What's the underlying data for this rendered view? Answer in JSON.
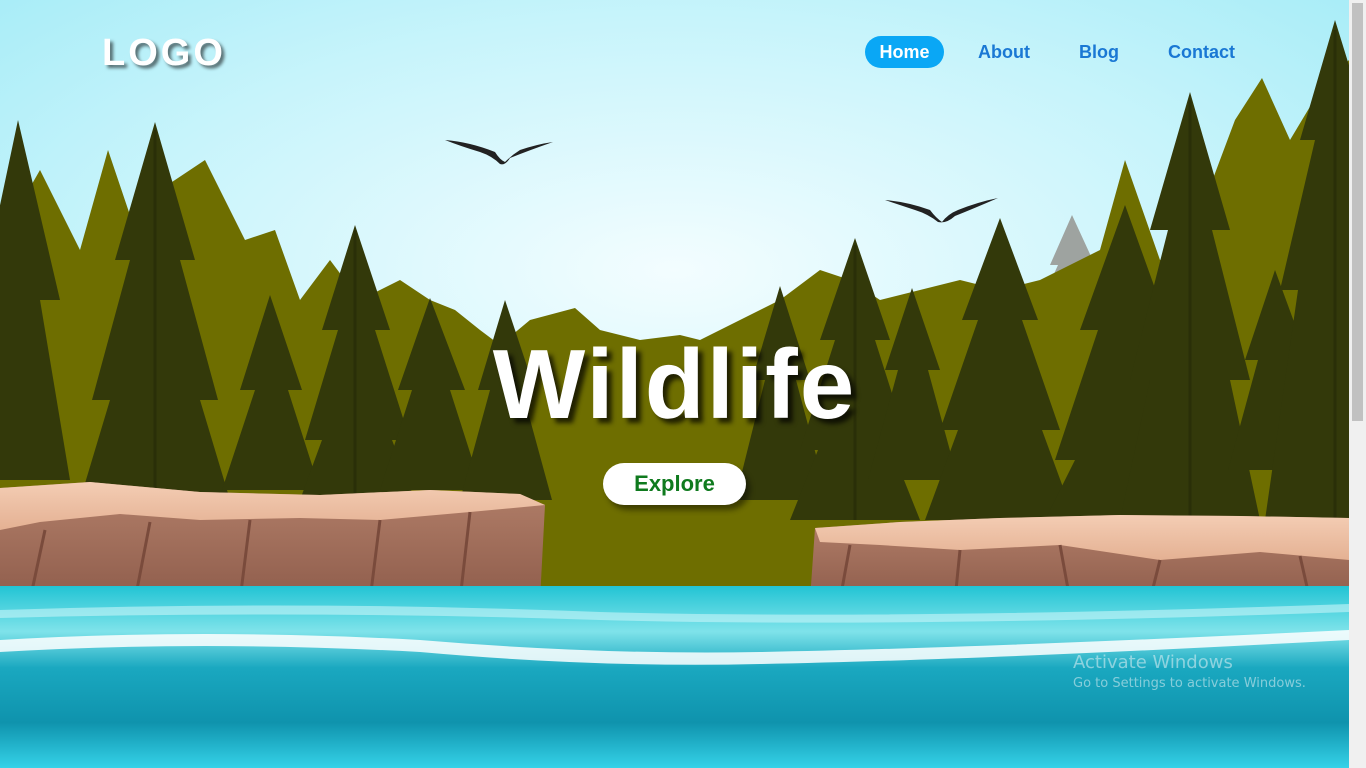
{
  "logo": {
    "text": "LOGO"
  },
  "nav": {
    "items": [
      {
        "label": "Home",
        "active": true
      },
      {
        "label": "About",
        "active": false
      },
      {
        "label": "Blog",
        "active": false
      },
      {
        "label": "Contact",
        "active": false
      }
    ]
  },
  "hero": {
    "title": "Wildlife",
    "button_label": "Explore"
  },
  "watermark": {
    "title": "Activate Windows",
    "subtitle": "Go to Settings to activate Windows."
  },
  "colors": {
    "nav_active_bg": "#0aa7f5",
    "nav_link": "#1a78d4",
    "button_text": "#0f7a1e",
    "forest_light": "#6e6e00",
    "forest_dark": "#33390a",
    "water": "#17b5cb"
  }
}
